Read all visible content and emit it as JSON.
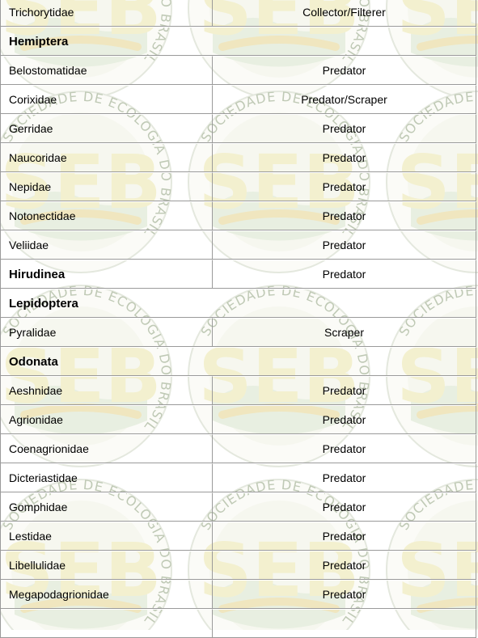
{
  "rows": [
    {
      "family": "Trichorytidae",
      "feeding": "Collector/Filterer",
      "type": "item"
    },
    {
      "family": "Hemiptera",
      "feeding": "",
      "type": "group"
    },
    {
      "family": "Belostomatidae",
      "feeding": "Predator",
      "type": "item"
    },
    {
      "family": "Corixidae",
      "feeding": "Predator/Scraper",
      "type": "item"
    },
    {
      "family": "Gerridae",
      "feeding": "Predator",
      "type": "item"
    },
    {
      "family": "Naucoridae",
      "feeding": "Predator",
      "type": "item"
    },
    {
      "family": "Nepidae",
      "feeding": "Predator",
      "type": "item"
    },
    {
      "family": "Notonectidae",
      "feeding": "Predator",
      "type": "item"
    },
    {
      "family": "Veliidae",
      "feeding": "Predator",
      "type": "item"
    },
    {
      "family": "Hirudinea",
      "feeding": "Predator",
      "type": "group-with-value"
    },
    {
      "family": "Lepidoptera",
      "feeding": "",
      "type": "group"
    },
    {
      "family": "Pyralidae",
      "feeding": "Scraper",
      "type": "item"
    },
    {
      "family": "Odonata",
      "feeding": "",
      "type": "group"
    },
    {
      "family": "Aeshnidae",
      "feeding": "Predator",
      "type": "item"
    },
    {
      "family": "Agrionidae",
      "feeding": "Predator",
      "type": "item"
    },
    {
      "family": "Coenagrionidae",
      "feeding": "Predator",
      "type": "item"
    },
    {
      "family": "Dicteriastidae",
      "feeding": "Predator",
      "type": "item"
    },
    {
      "family": "Gomphidae",
      "feeding": "Predator",
      "type": "item"
    },
    {
      "family": "Lestidae",
      "feeding": "Predator",
      "type": "item"
    },
    {
      "family": "Libellulidae",
      "feeding": "Predator",
      "type": "item"
    },
    {
      "family": "Megapodagrionidae",
      "feeding": "Predator",
      "type": "item"
    },
    {
      "family": "",
      "feeding": "",
      "type": "item"
    }
  ],
  "watermark": {
    "letters": "SEB",
    "ring_text": "SOCIEDADE DE ECOLOGIA DO BRASIL"
  }
}
